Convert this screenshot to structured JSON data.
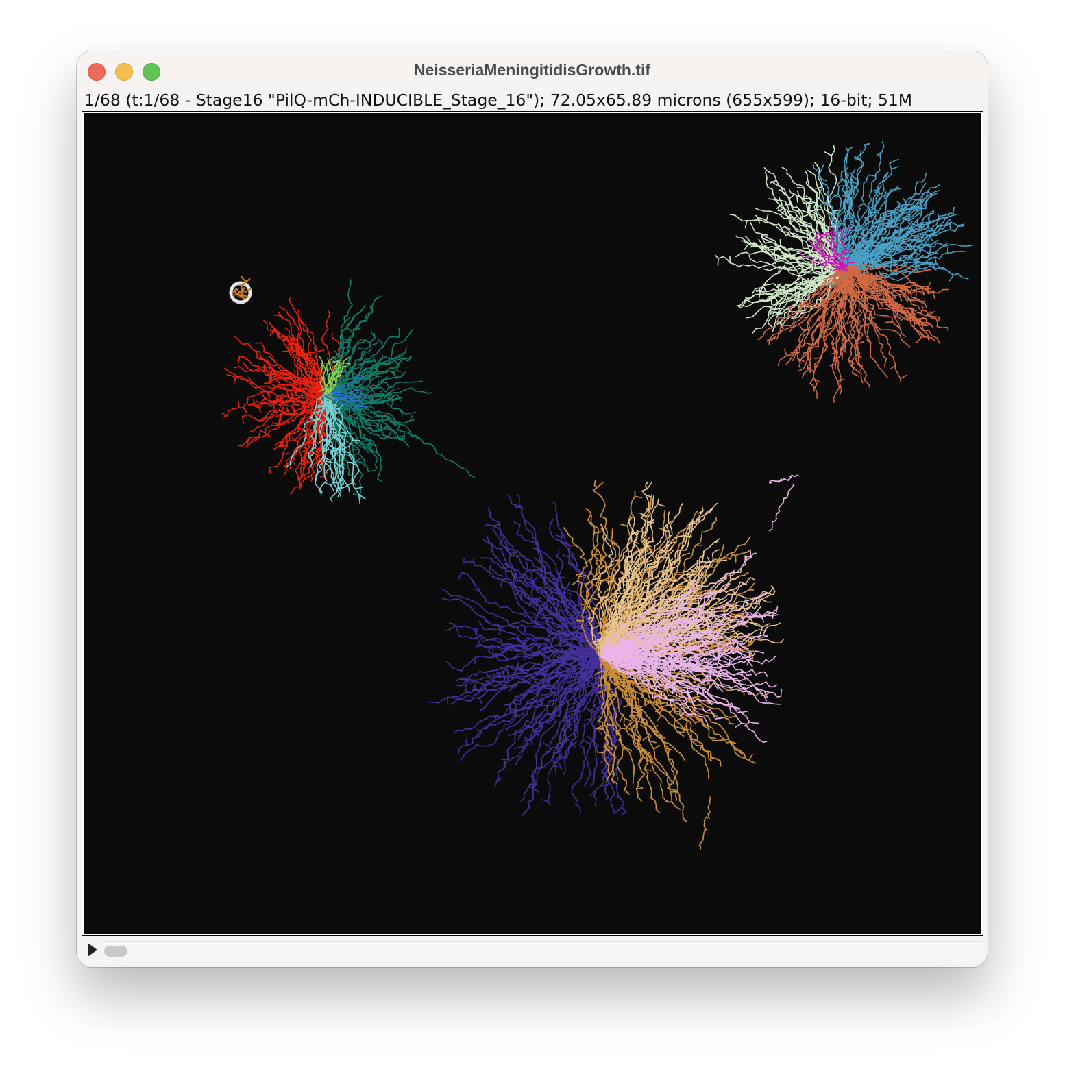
{
  "window": {
    "title": "NeisseriaMeningitidisGrowth.tif"
  },
  "infobar": {
    "text": "1/68 (t:1/68 - Stage16 \"PilQ-mCh-INDUCIBLE_Stage_16\"); 72.05x65.89 microns (655x599); 16-bit; 51M"
  },
  "image": {
    "background": "#0b0b0b",
    "colonies": [
      {
        "name": "small-colony",
        "colors": [
          "#c87a1c"
        ]
      },
      {
        "name": "left-colony",
        "colors": [
          "#e8220f",
          "#0f7d6a",
          "#7ccfd2",
          "#8fcf4f",
          "#2f6fd6"
        ]
      },
      {
        "name": "top-right-colony",
        "colors": [
          "#cfe6c7",
          "#4aa0c4",
          "#cf6a45",
          "#c21ab0"
        ]
      },
      {
        "name": "bottom-colony",
        "colors": [
          "#45309a",
          "#c98d3a",
          "#e7c38d",
          "#e9b5e8"
        ]
      }
    ]
  },
  "scrollbar": {
    "position": 0
  }
}
